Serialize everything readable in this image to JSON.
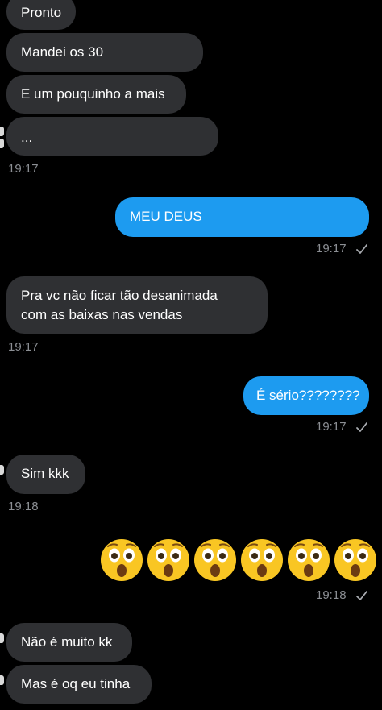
{
  "messages": {
    "m1": "Pronto",
    "m2": "Mandei os 30",
    "m3": "E um pouquinho a mais",
    "m4": "...",
    "t1": "19:17",
    "m5": "MEU DEUS",
    "t2": "19:17",
    "m6_line1": "Pra vc não ficar tão desanimada",
    "m6_line2": "com as baixas nas vendas",
    "t3": "19:17",
    "m7": "É sério????????",
    "t4": "19:17",
    "m8": "Sim kkk",
    "t5": "19:18",
    "t6": "19:18",
    "m10": "Não é muito kk",
    "m11": "Mas é oq eu tinha"
  },
  "icons": {
    "read_check": "check-icon",
    "reaction_emoji": "astonished-face-emoji"
  },
  "emoji_count": 6,
  "colors": {
    "background": "#000000",
    "incoming_bubble": "#2f3033",
    "outgoing_bubble": "#1d9bf0",
    "timestamp": "#8c8f94"
  }
}
